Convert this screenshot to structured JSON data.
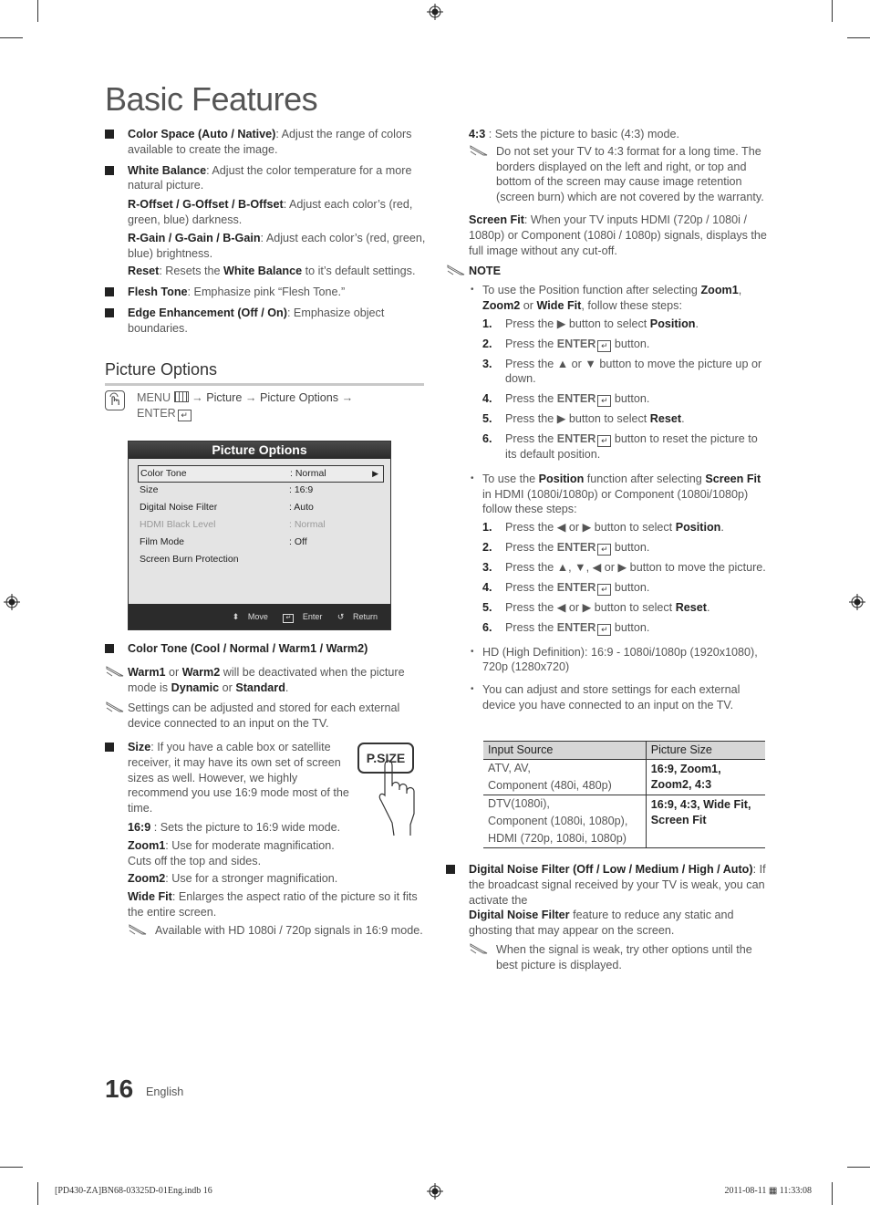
{
  "page": {
    "title": "Basic Features",
    "page_number": "16",
    "language": "English",
    "print_footer_left": "[PD430-ZA]BN68-03325D-01Eng.indb   16",
    "print_footer_right": "2011-08-11   ▦ 11:33:08"
  },
  "left_column": {
    "items": [
      {
        "bold": "Color Space (Auto / Native)",
        "text": ": Adjust the range of colors available to create the image."
      },
      {
        "bold": "White Balance",
        "text": ": Adjust the color temperature for a more natural picture."
      }
    ],
    "white_balance_sub": [
      {
        "bold": "R-Offset / G-Offset / B-Offset",
        "text": ": Adjust each color’s (red, green, blue) darkness."
      },
      {
        "bold": "R-Gain / G-Gain / B-Gain",
        "text": ": Adjust each color’s (red, green, blue) brightness."
      },
      {
        "bold": "Reset",
        "text": ": Resets the ",
        "bold2": "White Balance",
        "text2": " to it’s default settings."
      }
    ],
    "items2": [
      {
        "bold": "Flesh Tone",
        "text": ": Emphasize pink “Flesh Tone.”"
      },
      {
        "bold": "Edge Enhancement (Off / On)",
        "text": ": Emphasize object boundaries."
      }
    ],
    "section_heading": "Picture Options",
    "menu_path": {
      "menu": "MENU",
      "arrow1": " → ",
      "picture": "Picture",
      "arrow2": " → ",
      "options": "Picture Options",
      "arrow3": " →",
      "enter": "ENTER"
    },
    "osd": {
      "title": "Picture Options",
      "rows": [
        {
          "label": "Color Tone",
          "value": ": Normal",
          "selected": true,
          "dimmed": false
        },
        {
          "label": "Size",
          "value": ": 16:9",
          "selected": false,
          "dimmed": false
        },
        {
          "label": "Digital Noise Filter",
          "value": ": Auto",
          "selected": false,
          "dimmed": false
        },
        {
          "label": "HDMI Black Level",
          "value": ": Normal",
          "selected": false,
          "dimmed": true
        },
        {
          "label": "Film Mode",
          "value": ": Off",
          "selected": false,
          "dimmed": false
        },
        {
          "label": "Screen Burn Protection",
          "value": "",
          "selected": false,
          "dimmed": false
        }
      ],
      "footer": {
        "move": "Move",
        "enter": "Enter",
        "return": "Return"
      }
    },
    "color_tone": {
      "bold": "Color Tone (Cool / Normal / Warm1 / Warm2)"
    },
    "note1": {
      "b1": "Warm1",
      "t1": " or ",
      "b2": "Warm2",
      "t2": " will be deactivated when the picture mode is ",
      "b3": "Dynamic",
      "t3": " or ",
      "b4": "Standard",
      "t4": "."
    },
    "note2": "Settings can be adjusted and stored for each external device connected to an input on the TV.",
    "size": {
      "bold": "Size",
      "text": ": If you have a cable box or satellite receiver, it may have its own set of screen sizes as well. However, we highly recommend you use 16:9 mode most of the time."
    },
    "psize_button": "P.SIZE",
    "size_modes": [
      {
        "bold": "16:9",
        "text": " : Sets the picture to 16:9 wide mode."
      },
      {
        "bold": "Zoom1",
        "text": ": Use for moderate magnification. Cuts off the top and sides."
      },
      {
        "bold": "Zoom2",
        "text": ": Use for a stronger magnification."
      },
      {
        "bold": "Wide Fit",
        "text": ": Enlarges the aspect ratio of the picture so it fits the entire screen."
      }
    ],
    "note3": "Available with HD 1080i / 720p signals in 16:9 mode."
  },
  "right_column": {
    "mode_43": {
      "bold": "4:3",
      "text": " : Sets the picture to basic (4:3) mode."
    },
    "note_43": "Do not set your TV to 4:3 format for a long time. The borders displayed on the left and right, or top and bottom of the screen may cause image retention (screen burn) which are not covered by the warranty.",
    "screen_fit": {
      "bold": "Screen Fit",
      "text": ": When your TV inputs HDMI (720p / 1080i / 1080p) or Component (1080i / 1080p) signals, displays the full image without any cut-off."
    },
    "note_heading": "NOTE",
    "bullet1": {
      "t1": "To use the Position function after selecting ",
      "b1": "Zoom1",
      "t2": ", ",
      "b2": "Zoom2",
      "t3": " or ",
      "b3": "Wide Fit",
      "t4": ", follow these steps:"
    },
    "steps1": [
      {
        "n": "1.",
        "t": "Press the ▶ button to select ",
        "b": "Position",
        "e": "."
      },
      {
        "n": "2.",
        "t": "Press the ",
        "enter": "ENTER",
        "e": " button."
      },
      {
        "n": "3.",
        "t": "Press the ▲ or ▼ button to move the picture up or down.",
        "e": ""
      },
      {
        "n": "4.",
        "t": "Press the ",
        "enter": "ENTER",
        "e": " button."
      },
      {
        "n": "5.",
        "t": "Press the ▶ button to select ",
        "b": "Reset",
        "e": "."
      },
      {
        "n": "6.",
        "t": "Press the ",
        "enter": "ENTER",
        "e": " button to reset the picture to its default position."
      }
    ],
    "bullet2": {
      "t1": "To use the ",
      "b1": "Position",
      "t2": " function after selecting ",
      "b2": "Screen Fit",
      "t3": " in HDMI (1080i/1080p) or Component (1080i/1080p) follow these steps:"
    },
    "steps2": [
      {
        "n": "1.",
        "t": "Press the ◀ or ▶ button to select ",
        "b": "Position",
        "e": "."
      },
      {
        "n": "2.",
        "t": "Press the ",
        "enter": "ENTER",
        "e": " button."
      },
      {
        "n": "3.",
        "t": "Press the ▲, ▼, ◀ or ▶ button to move the picture.",
        "e": ""
      },
      {
        "n": "4.",
        "t": "Press the ",
        "enter": "ENTER",
        "e": " button."
      },
      {
        "n": "5.",
        "t": "Press the ◀ or ▶ button to select ",
        "b": "Reset",
        "e": "."
      },
      {
        "n": "6.",
        "t": "Press the ",
        "enter": "ENTER",
        "e": " button."
      }
    ],
    "bullet3": "HD (High Definition): 16:9 - 1080i/1080p (1920x1080), 720p (1280x720)",
    "bullet4": "You can adjust and store settings for each external device you have connected to an input on the TV.",
    "table": {
      "headers": [
        "Input Source",
        "Picture Size"
      ],
      "rows": [
        {
          "source": [
            "ATV, AV,",
            "Component (480i, 480p)"
          ],
          "size": [
            "16:9, Zoom1,",
            "Zoom2, 4:3"
          ]
        },
        {
          "source": [
            "DTV(1080i),",
            "Component (1080i, 1080p),",
            "HDMI (720p, 1080i, 1080p)"
          ],
          "size": [
            "16:9, 4:3, Wide Fit,",
            "Screen Fit"
          ]
        }
      ]
    },
    "dnf": {
      "bold": "Digital Noise Filter (Off / Low / Medium / High / Auto)",
      "text": ": If the broadcast signal received by your TV is weak, you can activate the",
      "bold2": "Digital Noise Filter",
      "text2": " feature to reduce any static and ghosting that may appear on the screen."
    },
    "note_dnf": "When the signal is weak, try other options until the best picture is displayed."
  }
}
